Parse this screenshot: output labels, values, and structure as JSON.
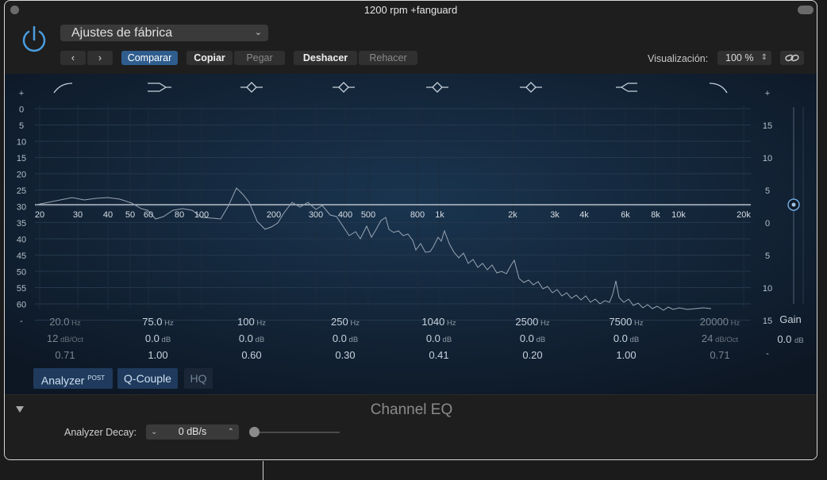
{
  "window": {
    "title": "1200 rpm +fanguard"
  },
  "header": {
    "preset": "Ajustes de fábrica",
    "compare_label": "Comparar",
    "copy_label": "Copiar",
    "paste_label": "Pegar",
    "undo_label": "Deshacer",
    "redo_label": "Rehacer",
    "view_label": "Visualización:",
    "zoom": "100 %",
    "colors": {
      "accent": "#2f5d8e",
      "power": "#4a9ee0"
    }
  },
  "graph": {
    "left_scale": [
      "+",
      "0",
      "5",
      "10",
      "15",
      "20",
      "25",
      "30",
      "35",
      "40",
      "45",
      "50",
      "55",
      "60",
      "-"
    ],
    "right_scale": [
      "+",
      "15",
      "10",
      "5",
      "0",
      "5",
      "10",
      "15",
      "-"
    ],
    "freq_labels": [
      "20",
      "30",
      "40",
      "50",
      "60",
      "80",
      "100",
      "200",
      "300",
      "400",
      "500",
      "800",
      "1k",
      "2k",
      "3k",
      "4k",
      "6k",
      "8k",
      "10k",
      "20k"
    ],
    "gain_label": "Gain",
    "gain_value": "0.0",
    "gain_unit": "dB"
  },
  "bands": [
    {
      "freq": "20.0",
      "freq_unit": "Hz",
      "gain": "12",
      "gain_unit": "dB/Oct",
      "q": "0.71",
      "active": false
    },
    {
      "freq": "75.0",
      "freq_unit": "Hz",
      "gain": "0.0",
      "gain_unit": "dB",
      "q": "1.00",
      "active": true
    },
    {
      "freq": "100",
      "freq_unit": "Hz",
      "gain": "0.0",
      "gain_unit": "dB",
      "q": "0.60",
      "active": true
    },
    {
      "freq": "250",
      "freq_unit": "Hz",
      "gain": "0.0",
      "gain_unit": "dB",
      "q": "0.30",
      "active": true
    },
    {
      "freq": "1040",
      "freq_unit": "Hz",
      "gain": "0.0",
      "gain_unit": "dB",
      "q": "0.41",
      "active": true
    },
    {
      "freq": "2500",
      "freq_unit": "Hz",
      "gain": "0.0",
      "gain_unit": "dB",
      "q": "0.20",
      "active": true
    },
    {
      "freq": "7500",
      "freq_unit": "Hz",
      "gain": "0.0",
      "gain_unit": "dB",
      "q": "1.00",
      "active": true
    },
    {
      "freq": "20000",
      "freq_unit": "Hz",
      "gain": "24",
      "gain_unit": "dB/Oct",
      "q": "0.71",
      "active": false
    }
  ],
  "bottom_buttons": {
    "analyzer": "Analyzer",
    "analyzer_sup": "POST",
    "qcouple": "Q-Couple",
    "hq": "HQ"
  },
  "footer": {
    "plugin_name": "Channel EQ",
    "decay_label": "Analyzer Decay:",
    "decay_value": "0 dB/s"
  }
}
